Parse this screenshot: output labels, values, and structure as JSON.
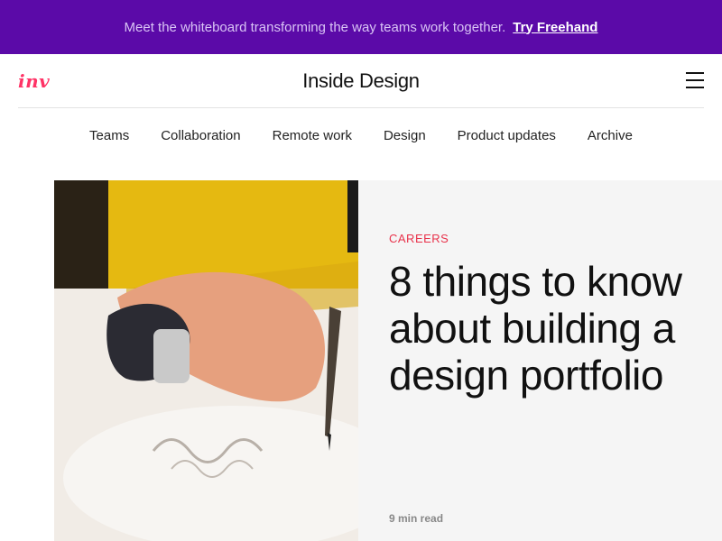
{
  "promo": {
    "text": "Meet the whiteboard transforming the way teams work together.",
    "link": "Try Freehand"
  },
  "header": {
    "logo": "inv",
    "brand": "Inside Design"
  },
  "nav": {
    "items": [
      "Teams",
      "Collaboration",
      "Remote work",
      "Design",
      "Product updates",
      "Archive"
    ]
  },
  "feature": {
    "category": "CAREERS",
    "title": "8 things to know about building a design portfolio",
    "read_time": "9 min read"
  },
  "colors": {
    "promo_bg": "#5b0aa8",
    "accent": "#ff3366",
    "category": "#e8324b"
  }
}
